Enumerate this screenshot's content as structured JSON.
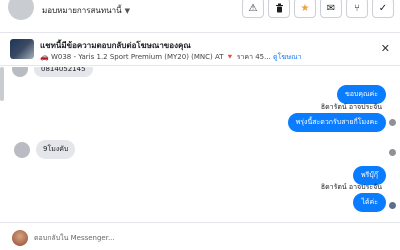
{
  "header": {
    "name_stub": "",
    "subtitle": "มอบหมายการสนทนานี้",
    "icons": [
      "warning-icon",
      "trash-icon",
      "star-icon",
      "mail-icon",
      "filter-icon",
      "check-icon"
    ]
  },
  "banner": {
    "title": "แชทนี้มีข้อความตอบกลับต่อโฆษณาของคุณ",
    "detail_text": "🚗 W038 - Yaris 1.2 Sport Premium (MY20) (MNC) AT 🔻 ราคา 45...",
    "link_label": "ดูโฆษณา"
  },
  "messages": {
    "partial_number": "0814052145",
    "out_1": "ขอบคุณค่ะ",
    "sender_1": "ธิดารัตน์ อาจประจัน",
    "out_2": "พรุ่งนี้สะดวกรับสายกี่โมงคะ",
    "in_1": "9โมงคับ",
    "out_3": "พรีบุ๊กุ๊",
    "sender_2": "ธิดารัตน์ อาจประจัน",
    "out_4": "ได้ค่ะ"
  },
  "composer": {
    "placeholder": "ตอบกลับใน Messenger..."
  },
  "colors": {
    "accent": "#0a7cff",
    "incoming": "#e4e6eb",
    "star": "#e8a43b"
  }
}
